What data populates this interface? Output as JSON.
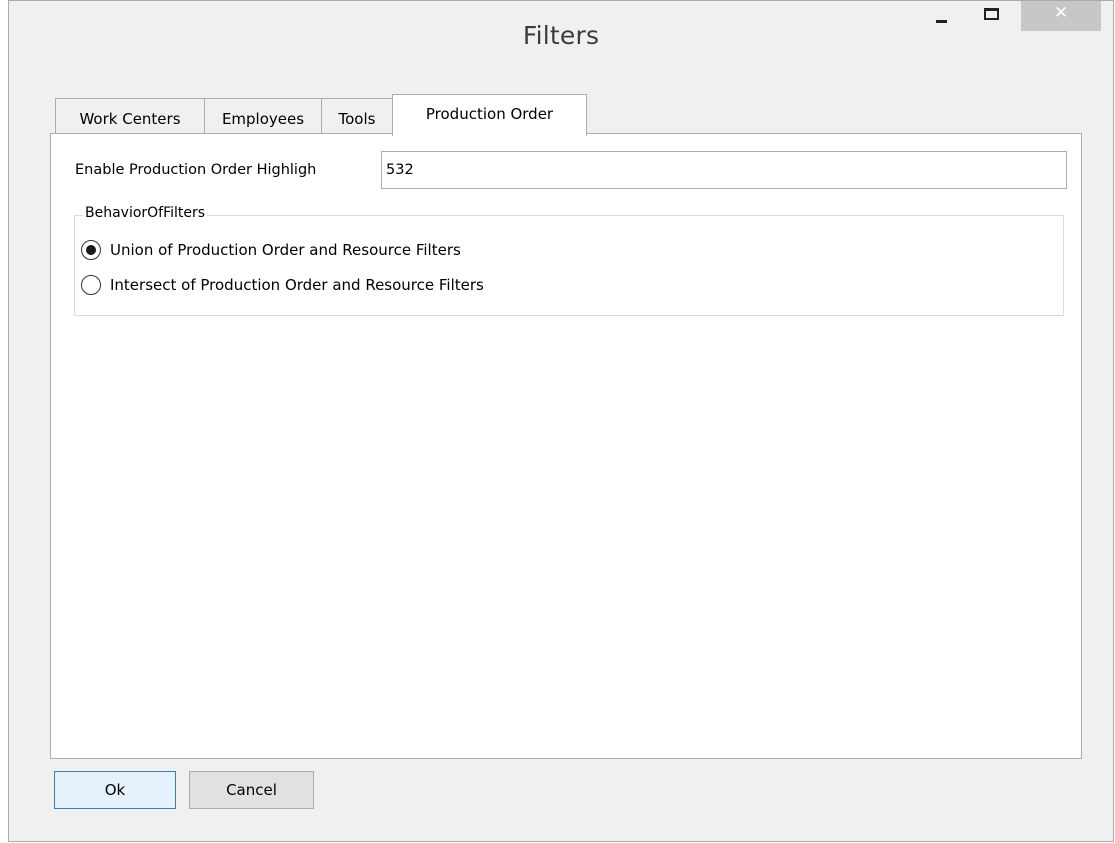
{
  "window": {
    "title": "Filters",
    "minimize_icon": "minimize-icon",
    "maximize_icon": "maximize-icon",
    "close_icon": "close-icon",
    "close_glyph": "✕"
  },
  "tabs": [
    {
      "label": "Work Centers",
      "active": false
    },
    {
      "label": "Employees",
      "active": false
    },
    {
      "label": "Tools",
      "active": false
    },
    {
      "label": "Production Order",
      "active": true
    }
  ],
  "production_order": {
    "highlight_label": "Enable Production Order Highligh",
    "highlight_value": "532",
    "group_title": "BehaviorOfFilters",
    "options": [
      {
        "label": "Union of Production Order and Resource Filters",
        "selected": true
      },
      {
        "label": "Intersect of Production Order and Resource Filters",
        "selected": false
      }
    ]
  },
  "buttons": {
    "ok_label": "Ok",
    "cancel_label": "Cancel"
  },
  "colors": {
    "ok_border": "#3c7fb1",
    "ok_background": "#e5f1fb",
    "window_background": "#f0f0f0"
  }
}
